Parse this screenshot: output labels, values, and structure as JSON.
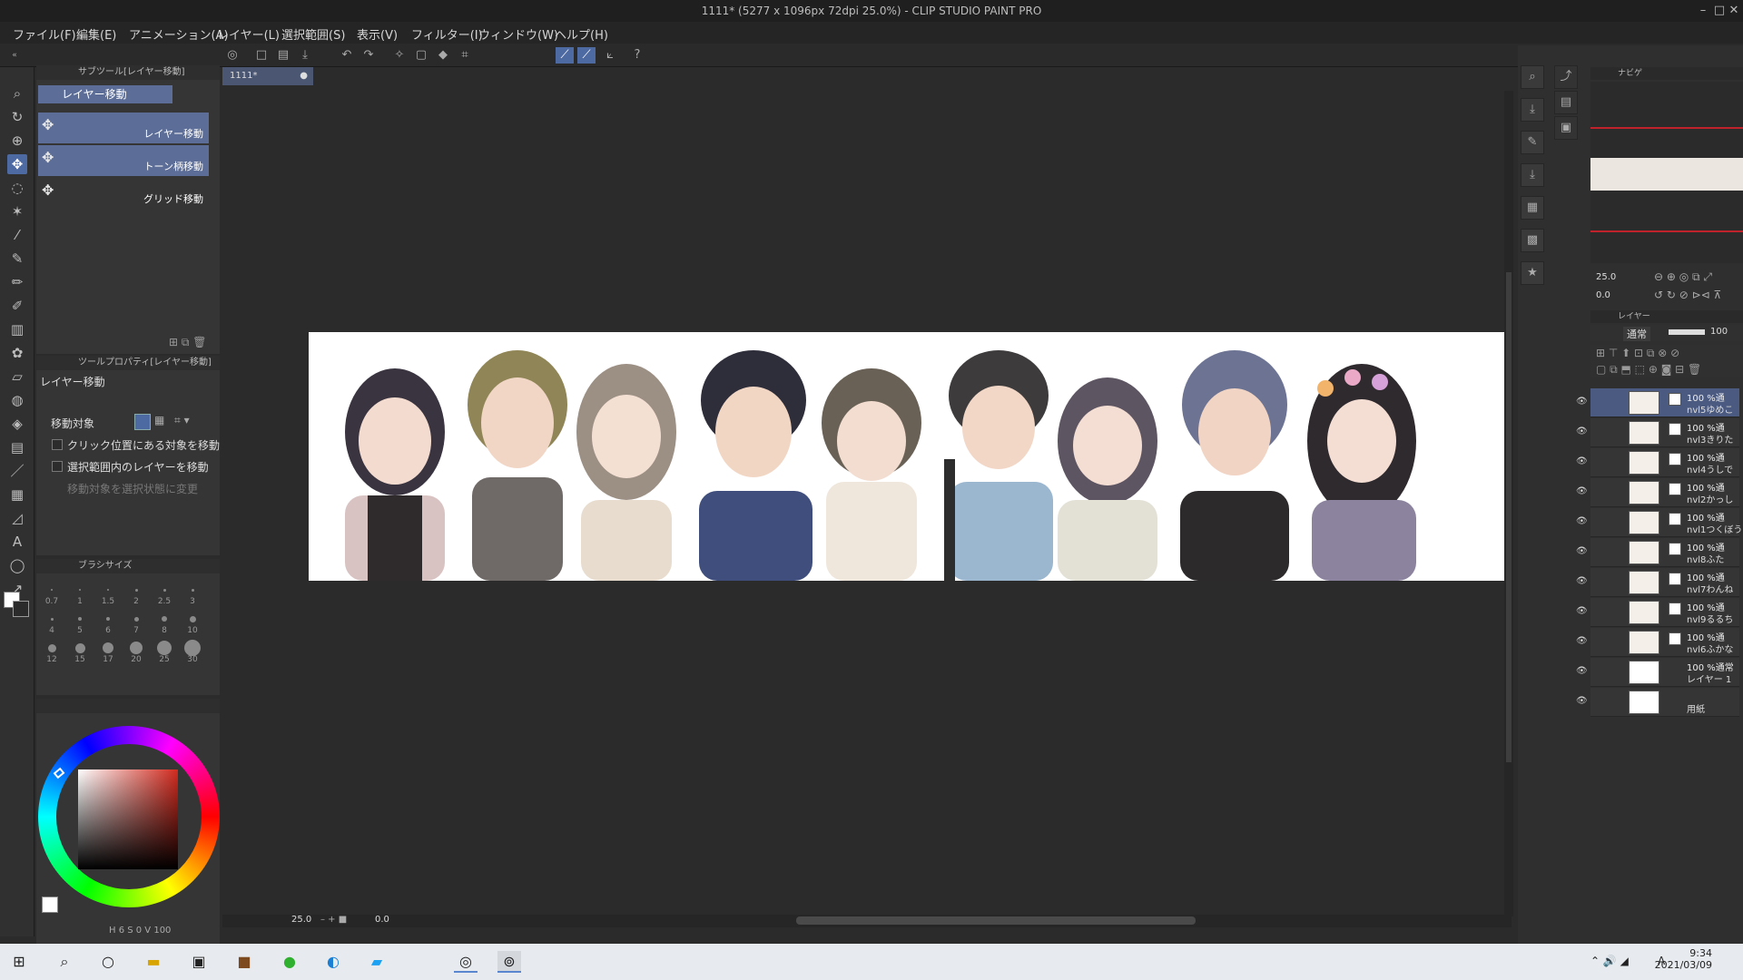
{
  "window": {
    "title": "1111* (5277 x 1096px 72dpi 25.0%) - CLIP STUDIO PAINT PRO"
  },
  "menu": [
    "ファイル(F)",
    "編集(E)",
    "アニメーション(A)",
    "レイヤー(L)",
    "選択範囲(S)",
    "表示(V)",
    "フィルター(I)",
    "ウィンドウ(W)",
    "ヘルプ(H)"
  ],
  "subtool": {
    "header": "サブツール[レイヤー移動]",
    "group": "レイヤー移動",
    "items": [
      "レイヤー移動",
      "トーン柄移動",
      "グリッド移動"
    ]
  },
  "toolprop": {
    "header": "ツールプロパティ[レイヤー移動]",
    "title": "レイヤー移動",
    "target_label": "移動対象",
    "options": [
      "クリック位置にある対象を移動",
      "選択範囲内のレイヤーを移動",
      "移動対象を選択状態に変更"
    ]
  },
  "brushsize": {
    "header": "ブラシサイズ",
    "sizes": [
      "0.7",
      "1",
      "1.5",
      "2",
      "2.5",
      "3",
      "4",
      "5",
      "6",
      "7",
      "8",
      "10",
      "12",
      "15",
      "17",
      "20",
      "25",
      "30"
    ]
  },
  "color": {
    "main": "#ffffff",
    "hue": "#d12a1e"
  },
  "document": {
    "tab": "1111*"
  },
  "statusbar": {
    "zoom": "25.0",
    "angle": "0.0"
  },
  "navigator": {
    "header": "ナビゲ",
    "zoom": "25.0",
    "angle": "0.0"
  },
  "layers": {
    "header": "レイヤー",
    "blend": "通常",
    "opacity": "100",
    "items": [
      {
        "op": "100 %通",
        "name": "nvl5ゆめこ"
      },
      {
        "op": "100 %通",
        "name": "nvl3きりた"
      },
      {
        "op": "100 %通",
        "name": "nvl4うしで"
      },
      {
        "op": "100 %通",
        "name": "nvl2かっし"
      },
      {
        "op": "100 %通",
        "name": "nvl1つくぼう"
      },
      {
        "op": "100 %通",
        "name": "nvl8ふた"
      },
      {
        "op": "100 %通",
        "name": "nvl7わんね"
      },
      {
        "op": "100 %通",
        "name": "nvl9るるち"
      },
      {
        "op": "100 %通",
        "name": "nvl6ふかな"
      },
      {
        "op": "100 %通常",
        "name": "レイヤー 1"
      },
      {
        "op": "",
        "name": "用紙"
      }
    ]
  },
  "taskbar": {
    "time": "9:34",
    "date": "2021/03/09",
    "ime": "A"
  }
}
